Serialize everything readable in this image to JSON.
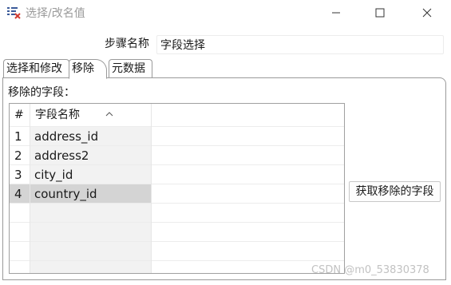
{
  "window": {
    "title": "选择/改名值",
    "app_icon": "spoon-transform-icon"
  },
  "step": {
    "label": "步骤名称",
    "value": "字段选择"
  },
  "tabs": [
    {
      "label": "选择和修改",
      "active": false
    },
    {
      "label": "移除",
      "active": true
    },
    {
      "label": "元数据",
      "active": false
    }
  ],
  "panel": {
    "label": "移除的字段：",
    "columns": [
      "#",
      "字段名称"
    ],
    "rows": [
      {
        "num": "1",
        "name": "address_id",
        "selected": false
      },
      {
        "num": "2",
        "name": "address2",
        "selected": false
      },
      {
        "num": "3",
        "name": "city_id",
        "selected": false
      },
      {
        "num": "4",
        "name": "country_id",
        "selected": true
      }
    ],
    "get_button": "获取移除的字段"
  },
  "watermark": "CSDN @m0_53830378"
}
